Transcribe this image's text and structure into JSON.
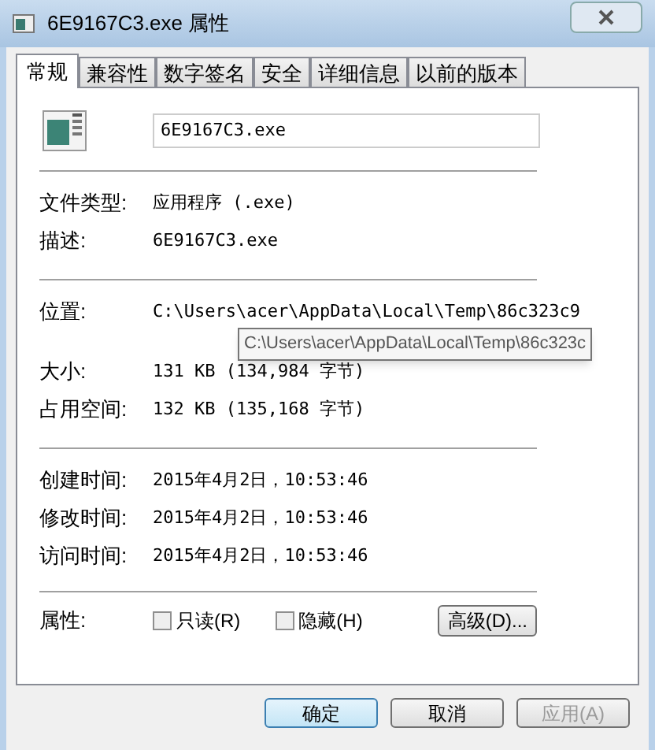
{
  "window": {
    "title": "6E9167C3.exe 属性"
  },
  "tabs": [
    {
      "label": "常规",
      "selected": true
    },
    {
      "label": "兼容性",
      "selected": false
    },
    {
      "label": "数字签名",
      "selected": false
    },
    {
      "label": "安全",
      "selected": false
    },
    {
      "label": "详细信息",
      "selected": false
    },
    {
      "label": "以前的版本",
      "selected": false
    }
  ],
  "file_name": "6E9167C3.exe",
  "sections": [
    [
      {
        "label": "文件类型:",
        "value": "应用程序 (.exe)"
      },
      {
        "label": "描述:",
        "value": "6E9167C3.exe"
      }
    ],
    [
      {
        "label": "位置:",
        "value": "C:\\Users\\acer\\AppData\\Local\\Temp\\86c323c9",
        "tooltip": "C:\\Users\\acer\\AppData\\Local\\Temp\\86c323c"
      },
      {
        "label": "大小:",
        "value": "131 KB (134,984 字节)"
      },
      {
        "label": "占用空间:",
        "value": "132 KB (135,168 字节)"
      }
    ],
    [
      {
        "label": "创建时间:",
        "value": "2015年4月2日，10:53:46"
      },
      {
        "label": "修改时间:",
        "value": "2015年4月2日，10:53:46"
      },
      {
        "label": "访问时间:",
        "value": "2015年4月2日，10:53:46"
      }
    ]
  ],
  "attributes": {
    "label": "属性:",
    "checkboxes": [
      {
        "label": "只读(R)",
        "checked": false
      },
      {
        "label": "隐藏(H)",
        "checked": false
      }
    ],
    "advanced_button": "高级(D)..."
  },
  "buttons": [
    {
      "label": "确定",
      "default": true,
      "disabled": false
    },
    {
      "label": "取消",
      "default": false,
      "disabled": false
    },
    {
      "label": "应用(A)",
      "default": false,
      "disabled": true
    }
  ]
}
